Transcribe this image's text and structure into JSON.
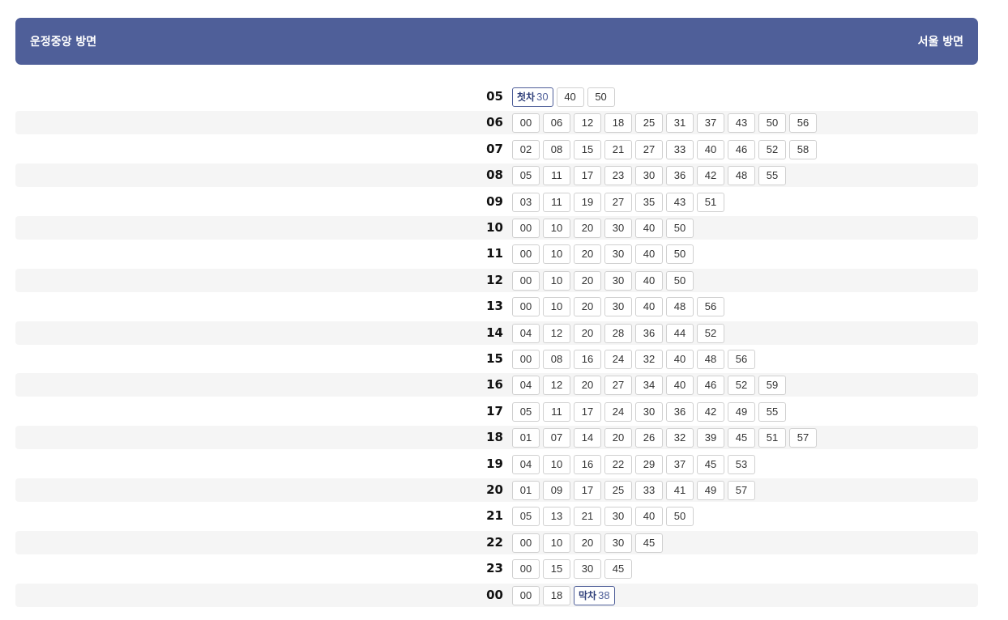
{
  "header": {
    "left_direction": "운정중앙 방면",
    "right_direction": "서울 방면"
  },
  "colors": {
    "header_bg": "#4f5f99",
    "row_shade": "#f5f5f5",
    "special_border": "#4f5f99"
  },
  "schedule": [
    {
      "hour": "05",
      "minutes": [
        {
          "m": "30",
          "tag": "첫차"
        },
        {
          "m": "40"
        },
        {
          "m": "50"
        }
      ]
    },
    {
      "hour": "06",
      "minutes": [
        {
          "m": "00"
        },
        {
          "m": "06"
        },
        {
          "m": "12"
        },
        {
          "m": "18"
        },
        {
          "m": "25"
        },
        {
          "m": "31"
        },
        {
          "m": "37"
        },
        {
          "m": "43"
        },
        {
          "m": "50"
        },
        {
          "m": "56"
        }
      ]
    },
    {
      "hour": "07",
      "minutes": [
        {
          "m": "02"
        },
        {
          "m": "08"
        },
        {
          "m": "15"
        },
        {
          "m": "21"
        },
        {
          "m": "27"
        },
        {
          "m": "33"
        },
        {
          "m": "40"
        },
        {
          "m": "46"
        },
        {
          "m": "52"
        },
        {
          "m": "58"
        }
      ]
    },
    {
      "hour": "08",
      "minutes": [
        {
          "m": "05"
        },
        {
          "m": "11"
        },
        {
          "m": "17"
        },
        {
          "m": "23"
        },
        {
          "m": "30"
        },
        {
          "m": "36"
        },
        {
          "m": "42"
        },
        {
          "m": "48"
        },
        {
          "m": "55"
        }
      ]
    },
    {
      "hour": "09",
      "minutes": [
        {
          "m": "03"
        },
        {
          "m": "11"
        },
        {
          "m": "19"
        },
        {
          "m": "27"
        },
        {
          "m": "35"
        },
        {
          "m": "43"
        },
        {
          "m": "51"
        }
      ]
    },
    {
      "hour": "10",
      "minutes": [
        {
          "m": "00"
        },
        {
          "m": "10"
        },
        {
          "m": "20"
        },
        {
          "m": "30"
        },
        {
          "m": "40"
        },
        {
          "m": "50"
        }
      ]
    },
    {
      "hour": "11",
      "minutes": [
        {
          "m": "00"
        },
        {
          "m": "10"
        },
        {
          "m": "20"
        },
        {
          "m": "30"
        },
        {
          "m": "40"
        },
        {
          "m": "50"
        }
      ]
    },
    {
      "hour": "12",
      "minutes": [
        {
          "m": "00"
        },
        {
          "m": "10"
        },
        {
          "m": "20"
        },
        {
          "m": "30"
        },
        {
          "m": "40"
        },
        {
          "m": "50"
        }
      ]
    },
    {
      "hour": "13",
      "minutes": [
        {
          "m": "00"
        },
        {
          "m": "10"
        },
        {
          "m": "20"
        },
        {
          "m": "30"
        },
        {
          "m": "40"
        },
        {
          "m": "48"
        },
        {
          "m": "56"
        }
      ]
    },
    {
      "hour": "14",
      "minutes": [
        {
          "m": "04"
        },
        {
          "m": "12"
        },
        {
          "m": "20"
        },
        {
          "m": "28"
        },
        {
          "m": "36"
        },
        {
          "m": "44"
        },
        {
          "m": "52"
        }
      ]
    },
    {
      "hour": "15",
      "minutes": [
        {
          "m": "00"
        },
        {
          "m": "08"
        },
        {
          "m": "16"
        },
        {
          "m": "24"
        },
        {
          "m": "32"
        },
        {
          "m": "40"
        },
        {
          "m": "48"
        },
        {
          "m": "56"
        }
      ]
    },
    {
      "hour": "16",
      "minutes": [
        {
          "m": "04"
        },
        {
          "m": "12"
        },
        {
          "m": "20"
        },
        {
          "m": "27"
        },
        {
          "m": "34"
        },
        {
          "m": "40"
        },
        {
          "m": "46"
        },
        {
          "m": "52"
        },
        {
          "m": "59"
        }
      ]
    },
    {
      "hour": "17",
      "minutes": [
        {
          "m": "05"
        },
        {
          "m": "11"
        },
        {
          "m": "17"
        },
        {
          "m": "24"
        },
        {
          "m": "30"
        },
        {
          "m": "36"
        },
        {
          "m": "42"
        },
        {
          "m": "49"
        },
        {
          "m": "55"
        }
      ]
    },
    {
      "hour": "18",
      "minutes": [
        {
          "m": "01"
        },
        {
          "m": "07"
        },
        {
          "m": "14"
        },
        {
          "m": "20"
        },
        {
          "m": "26"
        },
        {
          "m": "32"
        },
        {
          "m": "39"
        },
        {
          "m": "45"
        },
        {
          "m": "51"
        },
        {
          "m": "57"
        }
      ]
    },
    {
      "hour": "19",
      "minutes": [
        {
          "m": "04"
        },
        {
          "m": "10"
        },
        {
          "m": "16"
        },
        {
          "m": "22"
        },
        {
          "m": "29"
        },
        {
          "m": "37"
        },
        {
          "m": "45"
        },
        {
          "m": "53"
        }
      ]
    },
    {
      "hour": "20",
      "minutes": [
        {
          "m": "01"
        },
        {
          "m": "09"
        },
        {
          "m": "17"
        },
        {
          "m": "25"
        },
        {
          "m": "33"
        },
        {
          "m": "41"
        },
        {
          "m": "49"
        },
        {
          "m": "57"
        }
      ]
    },
    {
      "hour": "21",
      "minutes": [
        {
          "m": "05"
        },
        {
          "m": "13"
        },
        {
          "m": "21"
        },
        {
          "m": "30"
        },
        {
          "m": "40"
        },
        {
          "m": "50"
        }
      ]
    },
    {
      "hour": "22",
      "minutes": [
        {
          "m": "00"
        },
        {
          "m": "10"
        },
        {
          "m": "20"
        },
        {
          "m": "30"
        },
        {
          "m": "45"
        }
      ]
    },
    {
      "hour": "23",
      "minutes": [
        {
          "m": "00"
        },
        {
          "m": "15"
        },
        {
          "m": "30"
        },
        {
          "m": "45"
        }
      ]
    },
    {
      "hour": "00",
      "minutes": [
        {
          "m": "00"
        },
        {
          "m": "18"
        },
        {
          "m": "38",
          "tag": "막차"
        }
      ]
    }
  ]
}
